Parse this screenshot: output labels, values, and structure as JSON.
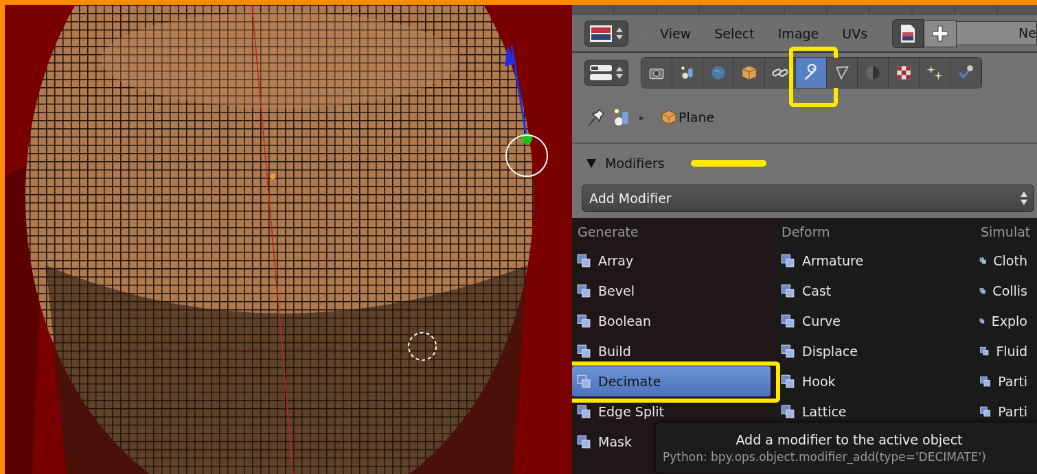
{
  "header": {
    "menus": [
      "View",
      "Select",
      "Image",
      "UVs"
    ],
    "new_button": "Ne"
  },
  "tabs": [
    {
      "selected": false,
      "annotated": false
    },
    {
      "selected": false,
      "annotated": false
    },
    {
      "selected": false,
      "annotated": false
    },
    {
      "selected": false,
      "annotated": false
    },
    {
      "selected": false,
      "annotated": false
    },
    {
      "selected": true,
      "annotated": true
    },
    {
      "selected": false,
      "annotated": false
    },
    {
      "selected": false,
      "annotated": false
    },
    {
      "selected": false,
      "annotated": false
    },
    {
      "selected": false,
      "annotated": false
    },
    {
      "selected": false,
      "annotated": false
    }
  ],
  "breadcrumb": {
    "separator": "▸",
    "object": "Plane"
  },
  "modifiers_panel": {
    "title": "Modifiers",
    "expanded": true,
    "underlined": true,
    "add_modifier": "Add Modifier",
    "menu": {
      "columns": [
        {
          "title": "Generate",
          "items": [
            {
              "label": "Array",
              "selected": false,
              "annotated": false
            },
            {
              "label": "Bevel",
              "selected": false,
              "annotated": false
            },
            {
              "label": "Boolean",
              "selected": false,
              "annotated": false
            },
            {
              "label": "Build",
              "selected": false,
              "annotated": false
            },
            {
              "label": "Decimate",
              "selected": true,
              "annotated": true
            },
            {
              "label": "Edge Split",
              "selected": false,
              "annotated": false
            },
            {
              "label": "Mask",
              "selected": false,
              "annotated": false
            }
          ]
        },
        {
          "title": "Deform",
          "items": [
            {
              "label": "Armature",
              "selected": false,
              "annotated": false
            },
            {
              "label": "Cast",
              "selected": false,
              "annotated": false
            },
            {
              "label": "Curve",
              "selected": false,
              "annotated": false
            },
            {
              "label": "Displace",
              "selected": false,
              "annotated": false
            },
            {
              "label": "Hook",
              "selected": false,
              "annotated": false
            },
            {
              "label": "Lattice",
              "selected": false,
              "annotated": false
            }
          ]
        },
        {
          "title": "Simulat",
          "items": [
            {
              "label": "Cloth",
              "selected": false,
              "annotated": false
            },
            {
              "label": "Collis",
              "selected": false,
              "annotated": false
            },
            {
              "label": "Explo",
              "selected": false,
              "annotated": false
            },
            {
              "label": "Fluid",
              "selected": false,
              "annotated": false
            },
            {
              "label": "Parti",
              "selected": false,
              "annotated": false
            },
            {
              "label": "Parti",
              "selected": false,
              "annotated": false
            }
          ]
        }
      ]
    }
  },
  "tooltip": {
    "text": "Add a modifier to the active object",
    "python": "Python: bpy.ops.object.modifier_add(type='DECIMATE')"
  }
}
